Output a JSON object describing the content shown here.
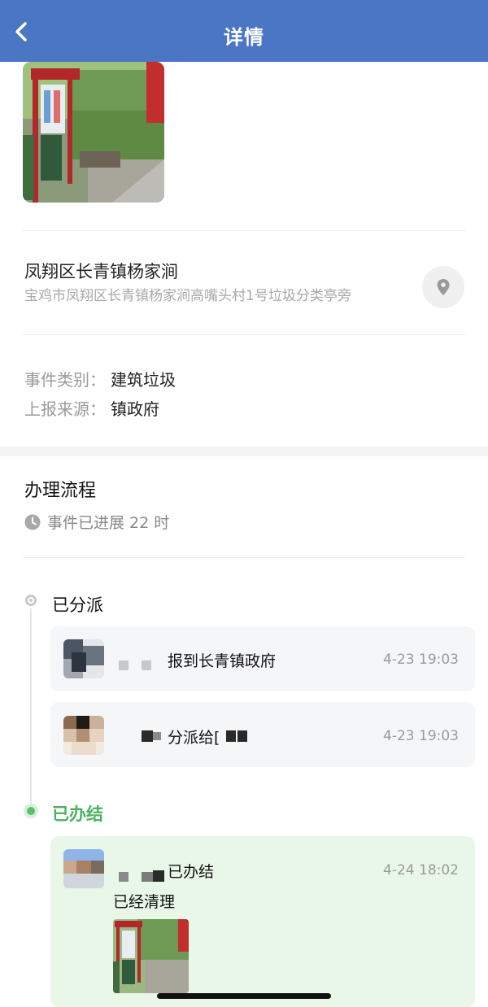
{
  "header": {
    "title": "详情"
  },
  "location": {
    "title": "凤翔区长青镇杨家涧",
    "address": "宝鸡市凤翔区长青镇杨家涧高嘴头村1号垃圾分类亭旁"
  },
  "meta": {
    "category_label": "事件类别：",
    "category_value": "建筑垃圾",
    "source_label": "上报来源：",
    "source_value": "镇政府"
  },
  "process": {
    "title": "办理流程",
    "elapsed": "事件已进展 22 时"
  },
  "timeline": {
    "assigned_label": "已分派",
    "done_label": "已办结",
    "entries": [
      {
        "text": "报到长青镇政府",
        "time": "4-23 19:03"
      },
      {
        "text": "分派给[",
        "time": "4-23 19:03"
      },
      {
        "text": "已办结",
        "time": "4-24 18:02",
        "comment": "已经清理"
      }
    ]
  },
  "colors": {
    "header": "#4a76c4",
    "done_green": "#4fb060",
    "done_card": "#e8f7e8"
  },
  "icons": {
    "back": "chevron-left-icon",
    "location": "location-pin-icon",
    "clock": "clock-icon"
  }
}
